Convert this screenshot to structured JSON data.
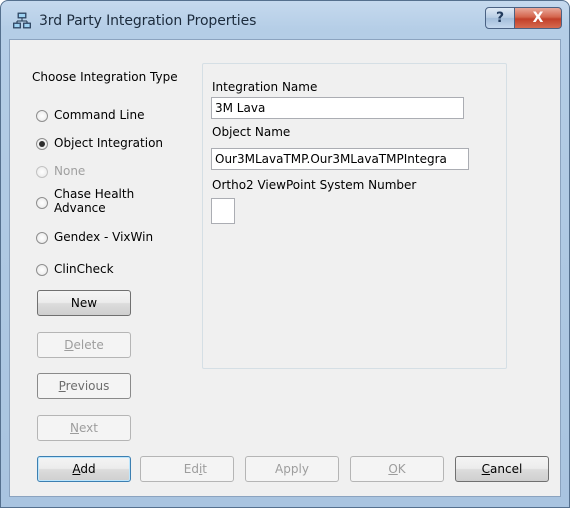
{
  "window": {
    "title": "3rd Party Integration Properties",
    "help_glyph": "?",
    "close_glyph": "X",
    "icon": "network-computers-icon"
  },
  "integration_type": {
    "heading": "Choose Integration Type",
    "options": [
      {
        "label": "Command Line",
        "checked": false,
        "enabled": true
      },
      {
        "label": "Object Integration",
        "checked": true,
        "enabled": true
      },
      {
        "label": "None",
        "checked": false,
        "enabled": false
      },
      {
        "label_line1": "Chase Health",
        "label_line2": "Advance",
        "checked": false,
        "enabled": true
      },
      {
        "label": "Gendex - VixWin",
        "checked": false,
        "enabled": true
      },
      {
        "label": "ClinCheck",
        "checked": false,
        "enabled": true
      }
    ]
  },
  "nav_buttons": {
    "new": "New",
    "delete_pre": "",
    "delete_key": "D",
    "delete_post": "elete",
    "previous_pre": "",
    "previous_key": "P",
    "previous_post": "revious",
    "next_pre": "",
    "next_key": "N",
    "next_post": "ext"
  },
  "details": {
    "integration_name_label": "Integration Name",
    "integration_name_value": "3M Lava",
    "object_name_label": "Object Name",
    "object_name_value": "Our3MLavaTMP.Our3MLavaTMPIntegra",
    "ortho2_label": "Ortho2 ViewPoint System Number",
    "ortho2_value": ""
  },
  "footer_buttons": {
    "add_key": "A",
    "add_post": "dd",
    "edit_pre": "Ed",
    "edit_key": "i",
    "edit_post": "t",
    "apply": "Apply",
    "ok_key": "O",
    "ok_post": "K",
    "cancel_key": "C",
    "cancel_post": "ancel"
  }
}
